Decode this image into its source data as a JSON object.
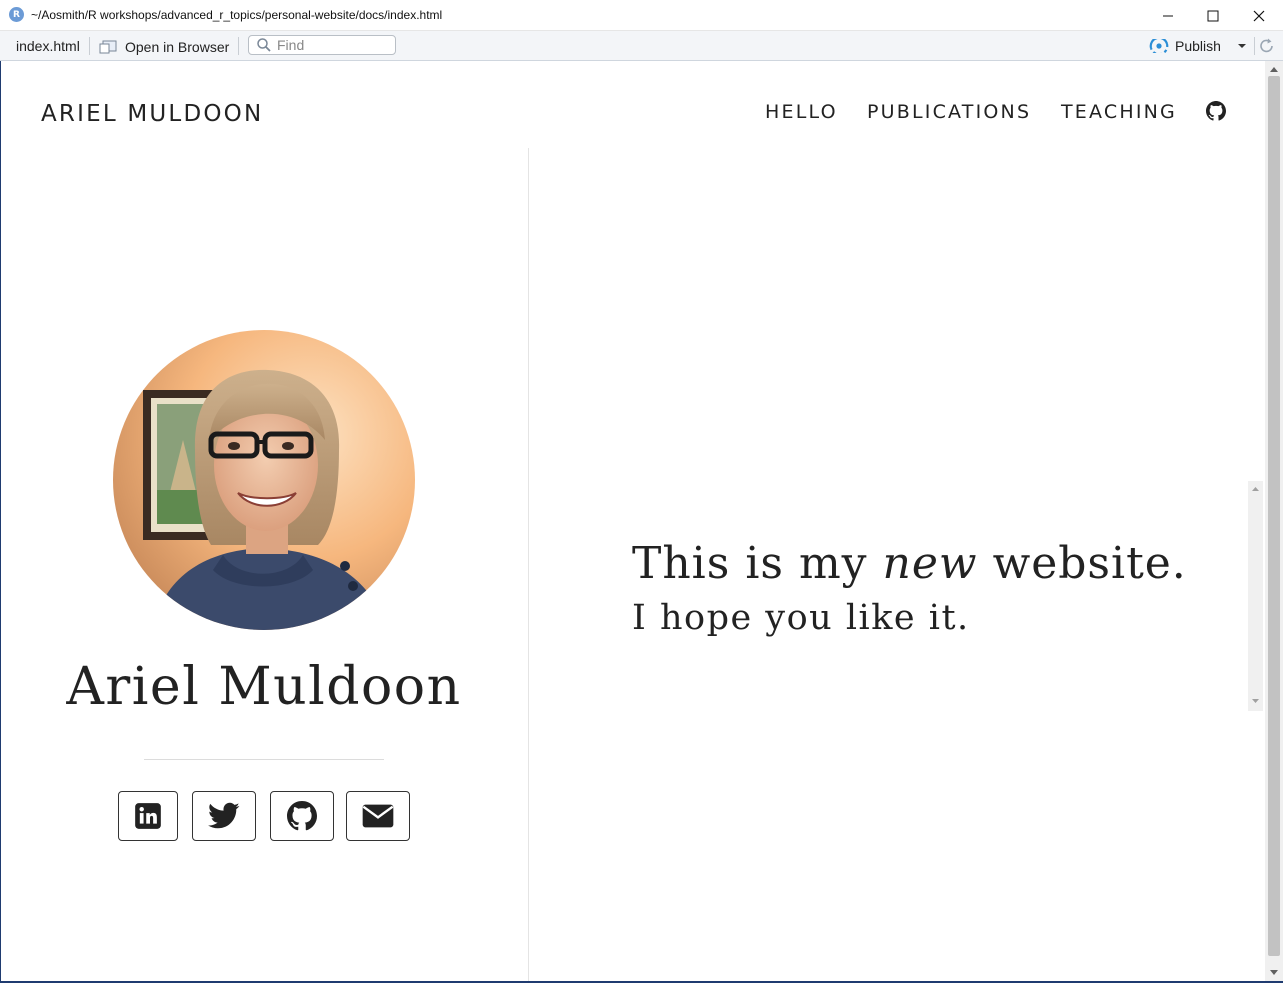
{
  "window": {
    "app_icon_letter": "R",
    "title": "~/Aosmith/R workshops/advanced_r_topics/personal-website/docs/index.html"
  },
  "toolbar": {
    "filename": "index.html",
    "open_in_browser": "Open in Browser",
    "find_placeholder": "Find",
    "publish": "Publish"
  },
  "site": {
    "brand": "ARIEL MULDOON",
    "nav": [
      "HELLO",
      "PUBLICATIONS",
      "TEACHING"
    ],
    "nav_icon": "github-icon",
    "person_name": "Ariel Muldoon",
    "social": [
      "linkedin-icon",
      "twitter-icon",
      "github-icon",
      "email-icon"
    ],
    "hero_prefix": "This is my ",
    "hero_emphasis": "new",
    "hero_suffix": " website.",
    "hero_line2": "I hope you like it."
  },
  "colors": {
    "text": "#222222",
    "publish_accent": "#2b8ed6",
    "window_border": "#1f3b70"
  }
}
